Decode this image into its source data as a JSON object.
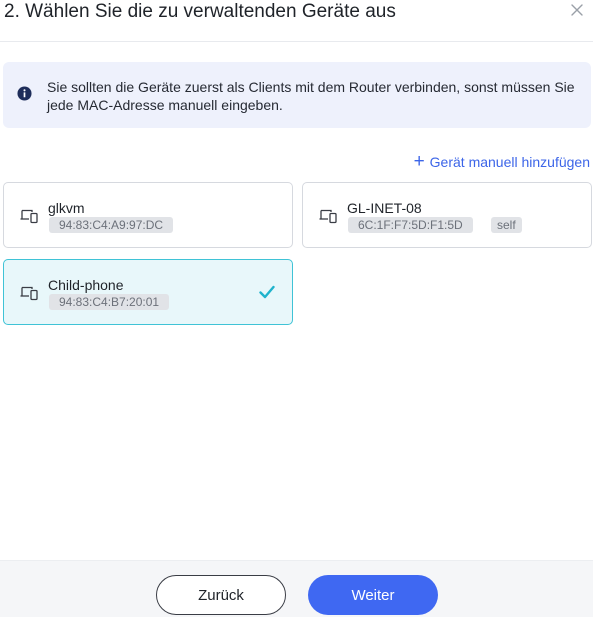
{
  "dialog": {
    "title": "2. Wählen Sie die zu verwaltenden Geräte aus",
    "close_icon": "close-icon"
  },
  "info": {
    "icon": "info-icon",
    "text": "Sie sollten die Geräte zuerst als Clients mit dem Router verbinden, sonst müssen Sie jede MAC-Adresse manuell eingeben."
  },
  "add_device": {
    "icon": "plus-icon",
    "label": "Gerät manuell hinzufügen"
  },
  "devices": [
    {
      "name": "glkvm",
      "mac": "94:83:C4:A9:97:DC",
      "badge": "",
      "selected": false,
      "icon": "devices-icon"
    },
    {
      "name": "GL-INET-08",
      "mac": "6C:1F:F7:5D:F1:5D",
      "badge": "self",
      "selected": false,
      "icon": "devices-icon"
    },
    {
      "name": "Child-phone",
      "mac": "94:83:C4:B7:20:01",
      "badge": "",
      "selected": true,
      "icon": "devices-icon"
    }
  ],
  "colors": {
    "accent": "#3f68f2",
    "link": "#3c65e8",
    "selected_border": "#3fc3d6",
    "selected_bg": "#e8f7fa",
    "check": "#1fb3cc",
    "info_bg": "#eef1fc"
  },
  "footer": {
    "back_label": "Zurück",
    "next_label": "Weiter"
  }
}
